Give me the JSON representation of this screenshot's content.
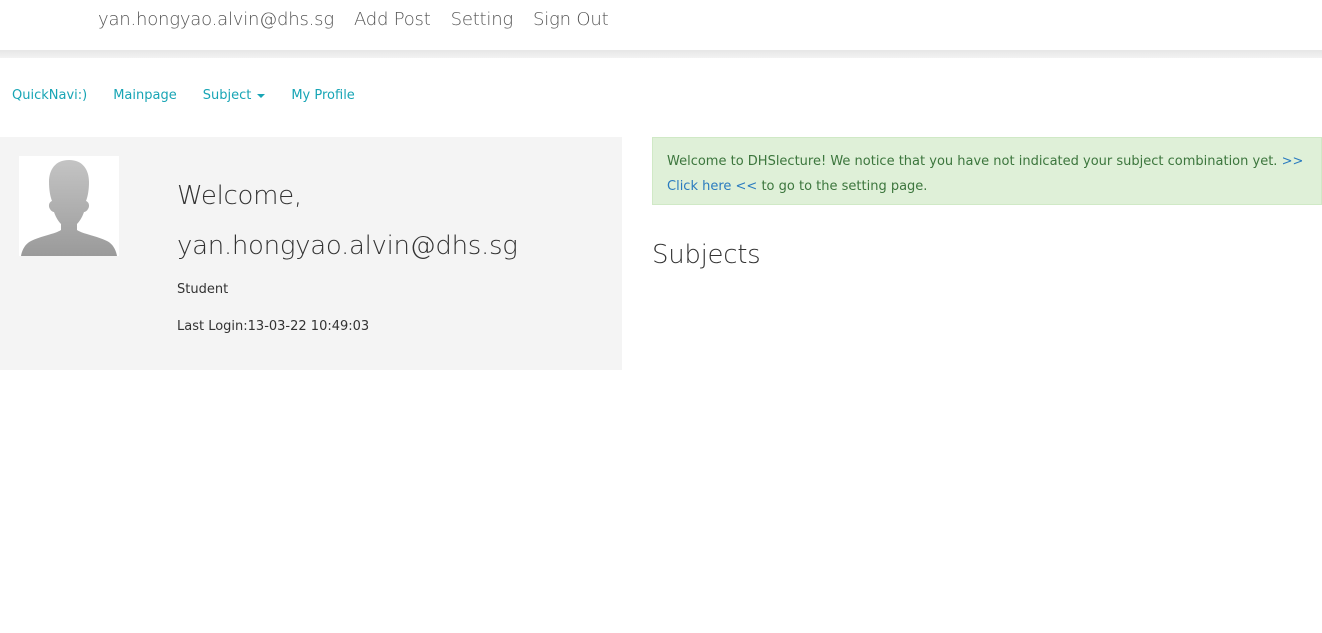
{
  "topnav": {
    "user_email": "yan.hongyao.alvin@dhs.sg",
    "add_post": "Add Post",
    "setting": "Setting",
    "sign_out": "Sign Out"
  },
  "quicknav": {
    "quicknavi": "QuickNavi:)",
    "mainpage": "Mainpage",
    "subject": "Subject",
    "my_profile": "My Profile"
  },
  "profile": {
    "avatar_icon": "user-silhouette-icon",
    "welcome": "Welcome,",
    "email": "yan.hongyao.alvin@dhs.sg",
    "role": "Student",
    "last_login": "Last Login:13-03-22 10:49:03"
  },
  "alert": {
    "text_before": "Welcome to DHSlecture! We notice that you have not indicated your subject combination yet. ",
    "link_open": ">>",
    "link_text": "Click here <<",
    "text_after": " to go to the setting page."
  },
  "subjects": {
    "title": "Subjects"
  },
  "colors": {
    "link": "#18a5b5",
    "alert_bg": "#dff0d8",
    "alert_text": "#3c763d",
    "alert_link": "#2a7bbf",
    "panel_bg": "#f4f4f4"
  }
}
